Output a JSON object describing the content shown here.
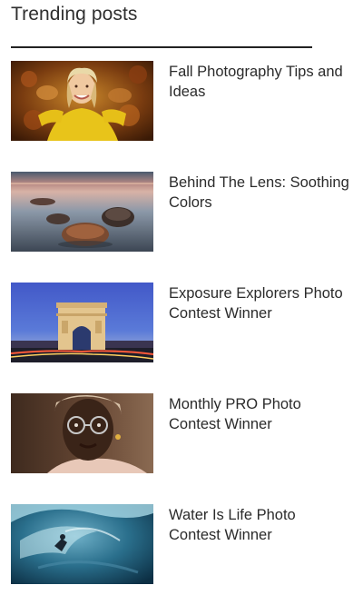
{
  "widget": {
    "title": "Trending posts"
  },
  "posts": [
    {
      "title": "Fall Photography Tips and Ideas",
      "thumbnail": "girl-in-autumn-leaves-photo"
    },
    {
      "title": "Behind The Lens: Soothing Colors",
      "thumbnail": "rocks-in-calm-water-photo"
    },
    {
      "title": "Exposure Explorers Photo Contest Winner",
      "thumbnail": "arc-de-triomphe-at-dusk-photo"
    },
    {
      "title": "Monthly PRO Photo Contest Winner",
      "thumbnail": "woman-portrait-with-glasses-photo"
    },
    {
      "title": "Water Is Life Photo Contest Winner",
      "thumbnail": "surfer-under-wave-photo"
    }
  ]
}
